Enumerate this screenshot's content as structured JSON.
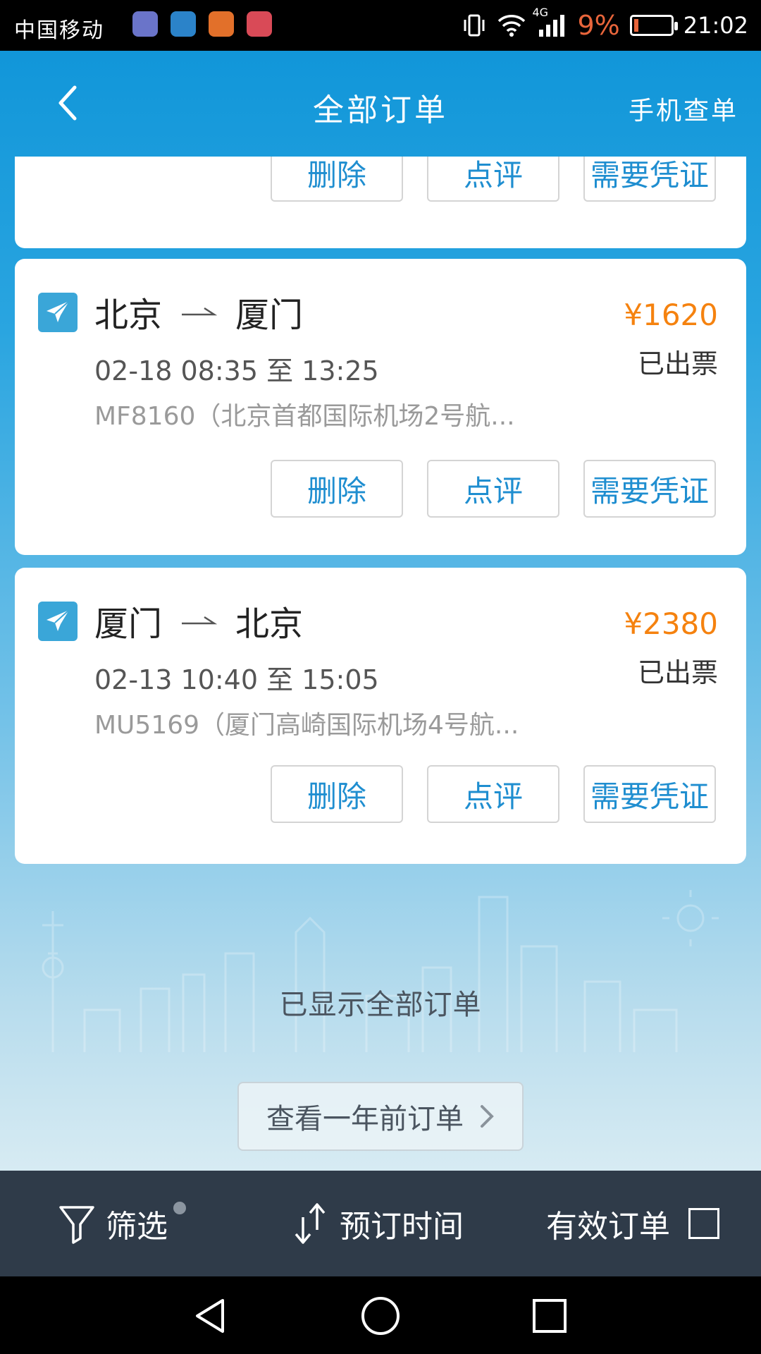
{
  "status_bar": {
    "carrier": "中国移动",
    "network": "4G",
    "battery_percent": "9%",
    "time": "21:02",
    "colors": {
      "battery_low": "#e8653b"
    }
  },
  "header": {
    "title": "全部订单",
    "right_action": "手机查单"
  },
  "orders": [
    {
      "buttons": {
        "delete": "删除",
        "review": "点评",
        "voucher": "需要凭证"
      }
    },
    {
      "from": "北京",
      "to": "厦门",
      "price": "¥1620",
      "status": "已出票",
      "times": "02-18 08:35 至 13:25",
      "flight": "MF8160（北京首都国际机场2号航...",
      "buttons": {
        "delete": "删除",
        "review": "点评",
        "voucher": "需要凭证"
      }
    },
    {
      "from": "厦门",
      "to": "北京",
      "price": "¥2380",
      "status": "已出票",
      "times": "02-13 10:40 至 15:05",
      "flight": "MU5169（厦门高崎国际机场4号航...",
      "buttons": {
        "delete": "删除",
        "review": "点评",
        "voucher": "需要凭证"
      }
    }
  ],
  "end_of_list": {
    "message": "已显示全部订单",
    "older_orders_button": "查看一年前订单"
  },
  "bottom_bar": {
    "filter": "筛选",
    "sort": "预订时间",
    "valid_orders": "有效订单",
    "valid_orders_checked": false
  },
  "theme": {
    "accent": "#1f8ed0",
    "price": "#f5820f",
    "bottom_bar_bg": "#2f3b49"
  }
}
